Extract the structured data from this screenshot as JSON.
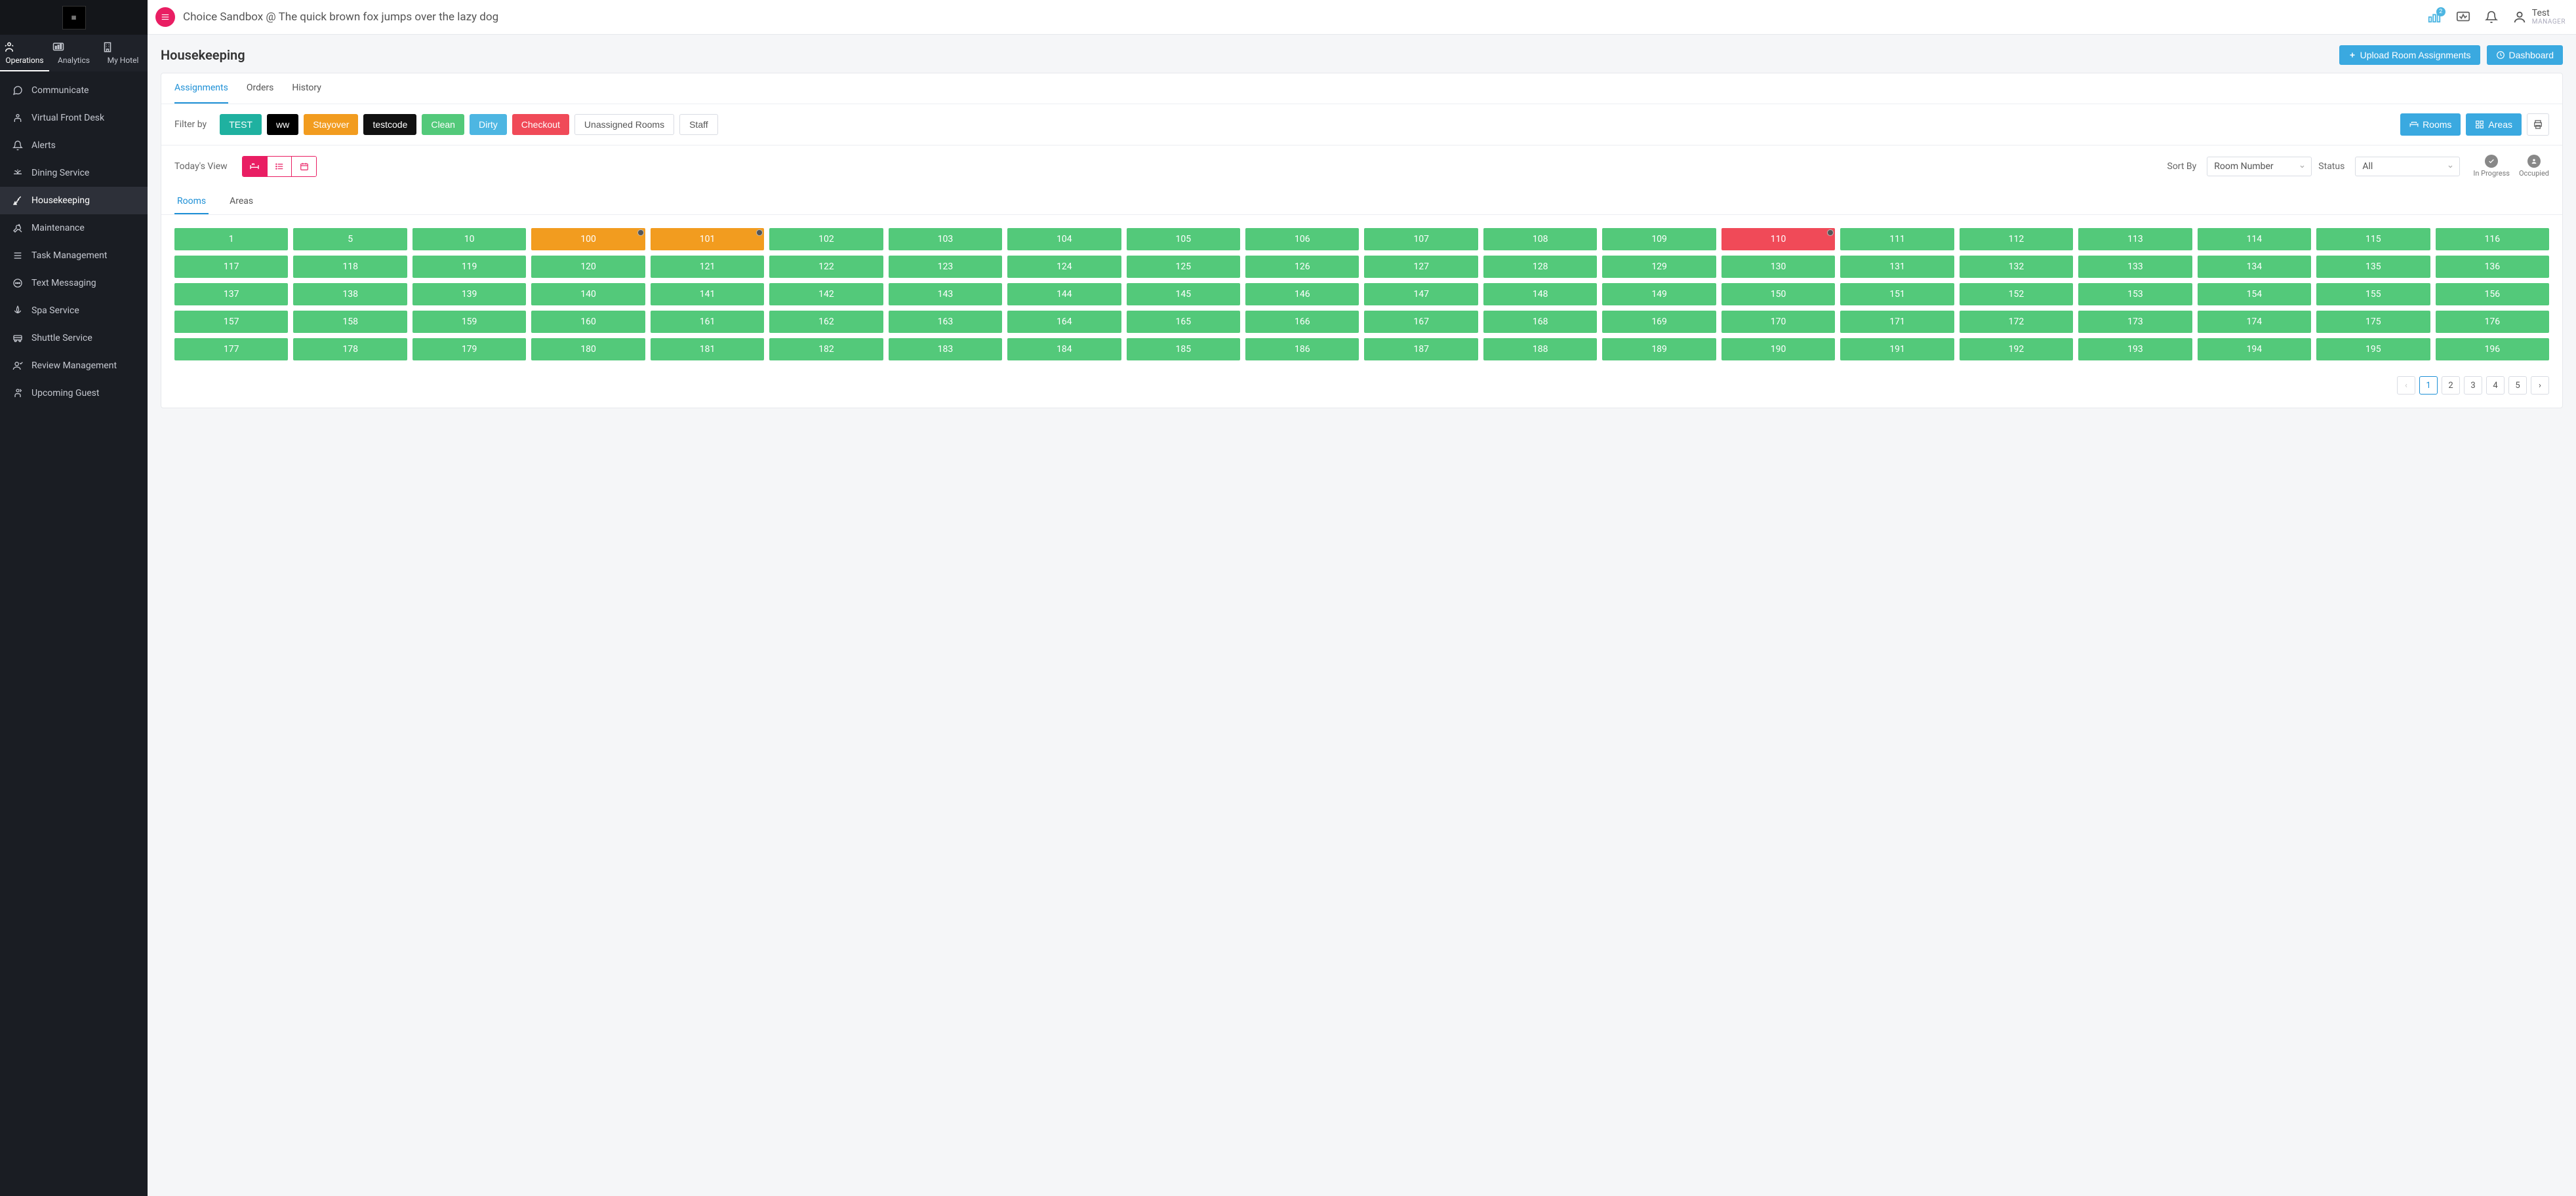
{
  "topbar": {
    "title": "Choice Sandbox @ The quick brown fox jumps over the lazy dog",
    "badge_count": "2",
    "user_name": "Test",
    "user_role": "MANAGER"
  },
  "topnav": {
    "items": [
      {
        "label": "Operations",
        "icon": "operations-icon",
        "active": true
      },
      {
        "label": "Analytics",
        "icon": "analytics-icon",
        "active": false
      },
      {
        "label": "My Hotel",
        "icon": "hotel-icon",
        "active": false
      }
    ]
  },
  "sidebar": {
    "items": [
      {
        "label": "Communicate",
        "icon": "chat-icon"
      },
      {
        "label": "Virtual Front Desk",
        "icon": "frontdesk-icon"
      },
      {
        "label": "Alerts",
        "icon": "bell-icon"
      },
      {
        "label": "Dining Service",
        "icon": "dining-icon"
      },
      {
        "label": "Housekeeping",
        "icon": "housekeeping-icon",
        "active": true
      },
      {
        "label": "Maintenance",
        "icon": "wrench-icon"
      },
      {
        "label": "Task Management",
        "icon": "tasks-icon"
      },
      {
        "label": "Text Messaging",
        "icon": "message-icon"
      },
      {
        "label": "Spa Service",
        "icon": "spa-icon"
      },
      {
        "label": "Shuttle Service",
        "icon": "shuttle-icon"
      },
      {
        "label": "Review Management",
        "icon": "review-icon"
      },
      {
        "label": "Upcoming Guest",
        "icon": "guest-icon"
      }
    ]
  },
  "header": {
    "title": "Housekeeping",
    "upload_label": "Upload Room Assignments",
    "dashboard_label": "Dashboard"
  },
  "tabs": [
    {
      "label": "Assignments",
      "active": true
    },
    {
      "label": "Orders",
      "active": false
    },
    {
      "label": "History",
      "active": false
    }
  ],
  "filter": {
    "label": "Filter by",
    "chips": [
      {
        "label": "TEST",
        "cls": "chip-teal"
      },
      {
        "label": "ww",
        "cls": "chip-black"
      },
      {
        "label": "Stayover",
        "cls": "chip-orange"
      },
      {
        "label": "testcode",
        "cls": "chip-blackalt"
      },
      {
        "label": "Clean",
        "cls": "chip-green"
      },
      {
        "label": "Dirty",
        "cls": "chip-lblue"
      },
      {
        "label": "Checkout",
        "cls": "chip-red"
      },
      {
        "label": "Unassigned Rooms",
        "cls": "chip-outline"
      },
      {
        "label": "Staff",
        "cls": "chip-outline"
      }
    ],
    "rooms_btn": "Rooms",
    "areas_btn": "Areas"
  },
  "view": {
    "label": "Today's View",
    "sort_label": "Sort By",
    "sort_value": "Room Number",
    "status_label": "Status",
    "status_value": "All",
    "legend_in_progress": "In Progress",
    "legend_occupied": "Occupied"
  },
  "subtabs": [
    {
      "label": "Rooms",
      "active": true
    },
    {
      "label": "Areas",
      "active": false
    }
  ],
  "rooms": [
    {
      "num": "1",
      "status": "clean"
    },
    {
      "num": "5",
      "status": "clean"
    },
    {
      "num": "10",
      "status": "clean"
    },
    {
      "num": "100",
      "status": "stay",
      "occ": true
    },
    {
      "num": "101",
      "status": "stay",
      "occ": true
    },
    {
      "num": "102",
      "status": "clean"
    },
    {
      "num": "103",
      "status": "clean"
    },
    {
      "num": "104",
      "status": "clean"
    },
    {
      "num": "105",
      "status": "clean"
    },
    {
      "num": "106",
      "status": "clean"
    },
    {
      "num": "107",
      "status": "clean"
    },
    {
      "num": "108",
      "status": "clean"
    },
    {
      "num": "109",
      "status": "clean"
    },
    {
      "num": "110",
      "status": "co",
      "occ": true
    },
    {
      "num": "111",
      "status": "clean"
    },
    {
      "num": "112",
      "status": "clean"
    },
    {
      "num": "113",
      "status": "clean"
    },
    {
      "num": "114",
      "status": "clean"
    },
    {
      "num": "115",
      "status": "clean"
    },
    {
      "num": "116",
      "status": "clean"
    },
    {
      "num": "117",
      "status": "clean"
    },
    {
      "num": "118",
      "status": "clean"
    },
    {
      "num": "119",
      "status": "clean"
    },
    {
      "num": "120",
      "status": "clean"
    },
    {
      "num": "121",
      "status": "clean"
    },
    {
      "num": "122",
      "status": "clean"
    },
    {
      "num": "123",
      "status": "clean"
    },
    {
      "num": "124",
      "status": "clean"
    },
    {
      "num": "125",
      "status": "clean"
    },
    {
      "num": "126",
      "status": "clean"
    },
    {
      "num": "127",
      "status": "clean"
    },
    {
      "num": "128",
      "status": "clean"
    },
    {
      "num": "129",
      "status": "clean"
    },
    {
      "num": "130",
      "status": "clean"
    },
    {
      "num": "131",
      "status": "clean"
    },
    {
      "num": "132",
      "status": "clean"
    },
    {
      "num": "133",
      "status": "clean"
    },
    {
      "num": "134",
      "status": "clean"
    },
    {
      "num": "135",
      "status": "clean"
    },
    {
      "num": "136",
      "status": "clean"
    },
    {
      "num": "137",
      "status": "clean"
    },
    {
      "num": "138",
      "status": "clean"
    },
    {
      "num": "139",
      "status": "clean"
    },
    {
      "num": "140",
      "status": "clean"
    },
    {
      "num": "141",
      "status": "clean"
    },
    {
      "num": "142",
      "status": "clean"
    },
    {
      "num": "143",
      "status": "clean"
    },
    {
      "num": "144",
      "status": "clean"
    },
    {
      "num": "145",
      "status": "clean"
    },
    {
      "num": "146",
      "status": "clean"
    },
    {
      "num": "147",
      "status": "clean"
    },
    {
      "num": "148",
      "status": "clean"
    },
    {
      "num": "149",
      "status": "clean"
    },
    {
      "num": "150",
      "status": "clean"
    },
    {
      "num": "151",
      "status": "clean"
    },
    {
      "num": "152",
      "status": "clean"
    },
    {
      "num": "153",
      "status": "clean"
    },
    {
      "num": "154",
      "status": "clean"
    },
    {
      "num": "155",
      "status": "clean"
    },
    {
      "num": "156",
      "status": "clean"
    },
    {
      "num": "157",
      "status": "clean"
    },
    {
      "num": "158",
      "status": "clean"
    },
    {
      "num": "159",
      "status": "clean"
    },
    {
      "num": "160",
      "status": "clean"
    },
    {
      "num": "161",
      "status": "clean"
    },
    {
      "num": "162",
      "status": "clean"
    },
    {
      "num": "163",
      "status": "clean"
    },
    {
      "num": "164",
      "status": "clean"
    },
    {
      "num": "165",
      "status": "clean"
    },
    {
      "num": "166",
      "status": "clean"
    },
    {
      "num": "167",
      "status": "clean"
    },
    {
      "num": "168",
      "status": "clean"
    },
    {
      "num": "169",
      "status": "clean"
    },
    {
      "num": "170",
      "status": "clean"
    },
    {
      "num": "171",
      "status": "clean"
    },
    {
      "num": "172",
      "status": "clean"
    },
    {
      "num": "173",
      "status": "clean"
    },
    {
      "num": "174",
      "status": "clean"
    },
    {
      "num": "175",
      "status": "clean"
    },
    {
      "num": "176",
      "status": "clean"
    },
    {
      "num": "177",
      "status": "clean"
    },
    {
      "num": "178",
      "status": "clean"
    },
    {
      "num": "179",
      "status": "clean"
    },
    {
      "num": "180",
      "status": "clean"
    },
    {
      "num": "181",
      "status": "clean"
    },
    {
      "num": "182",
      "status": "clean"
    },
    {
      "num": "183",
      "status": "clean"
    },
    {
      "num": "184",
      "status": "clean"
    },
    {
      "num": "185",
      "status": "clean"
    },
    {
      "num": "186",
      "status": "clean"
    },
    {
      "num": "187",
      "status": "clean"
    },
    {
      "num": "188",
      "status": "clean"
    },
    {
      "num": "189",
      "status": "clean"
    },
    {
      "num": "190",
      "status": "clean"
    },
    {
      "num": "191",
      "status": "clean"
    },
    {
      "num": "192",
      "status": "clean"
    },
    {
      "num": "193",
      "status": "clean"
    },
    {
      "num": "194",
      "status": "clean"
    },
    {
      "num": "195",
      "status": "clean"
    },
    {
      "num": "196",
      "status": "clean"
    }
  ],
  "pagination": {
    "pages": [
      "1",
      "2",
      "3",
      "4",
      "5"
    ],
    "active": "1"
  },
  "colors": {
    "accent_pink": "#e91e63",
    "accent_blue": "#3aa9e0",
    "clean": "#53c97a",
    "stayover": "#f29c1f",
    "checkout": "#f04a58",
    "dirty": "#4db6e2",
    "teal": "#1fb1a0"
  }
}
